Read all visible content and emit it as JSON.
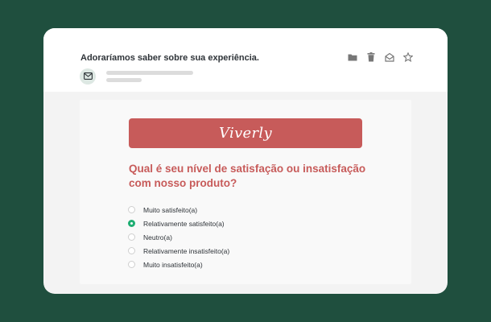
{
  "email": {
    "subject": "Adoraríamos saber sobre sua experiência.",
    "toolbar": [
      {
        "name": "folder-icon"
      },
      {
        "name": "trash-icon"
      },
      {
        "name": "envelope-open-icon"
      },
      {
        "name": "star-icon"
      }
    ],
    "sender_icon": "envelope-icon"
  },
  "body": {
    "brand": "Viverly",
    "question": "Qual é seu nível de satisfação ou insatisfação com nosso produto?",
    "options": [
      {
        "label": "Muito satisfeito(a)",
        "selected": false
      },
      {
        "label": "Relativamente satisfeito(a)",
        "selected": true
      },
      {
        "label": "Neutro(a)",
        "selected": false
      },
      {
        "label": "Relativamente insatisfeito(a)",
        "selected": false
      },
      {
        "label": "Muito insatisfeito(a)",
        "selected": false
      }
    ]
  },
  "colors": {
    "background": "#1f4f3e",
    "brand": "#c75b5a",
    "selected": "#1fae73"
  }
}
